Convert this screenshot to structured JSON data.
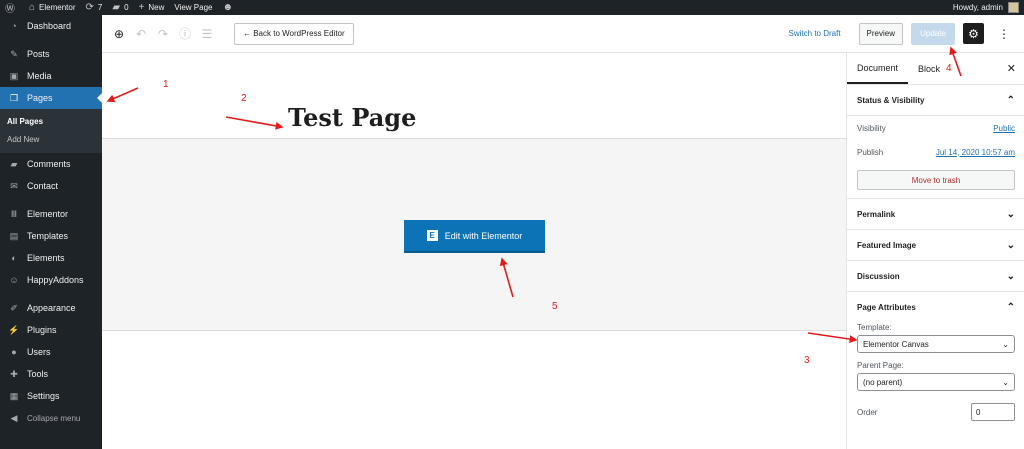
{
  "adminbar": {
    "site_name": "Elementor",
    "updates_count": "7",
    "comments_count": "0",
    "new_label": "New",
    "view_page_label": "View Page",
    "greeting": "Howdy, admin"
  },
  "sidebar": {
    "items": [
      {
        "label": "Dashboard",
        "icon": "dashboard-icon"
      },
      {
        "label": "Posts",
        "icon": "pin-icon"
      },
      {
        "label": "Media",
        "icon": "media-icon"
      },
      {
        "label": "Pages",
        "icon": "pages-icon"
      },
      {
        "label": "Comments",
        "icon": "comment-icon"
      },
      {
        "label": "Contact",
        "icon": "mail-icon"
      },
      {
        "label": "Elementor",
        "icon": "elementor-icon"
      },
      {
        "label": "Templates",
        "icon": "folder-icon"
      },
      {
        "label": "Elements",
        "icon": "elements-icon"
      },
      {
        "label": "HappyAddons",
        "icon": "happy-icon"
      },
      {
        "label": "Appearance",
        "icon": "brush-icon"
      },
      {
        "label": "Plugins",
        "icon": "plug-icon"
      },
      {
        "label": "Users",
        "icon": "user-icon"
      },
      {
        "label": "Tools",
        "icon": "wrench-icon"
      },
      {
        "label": "Settings",
        "icon": "settings-icon"
      }
    ],
    "submenu": [
      "All Pages",
      "Add New"
    ],
    "collapse_label": "Collapse menu"
  },
  "toolbar": {
    "back_label": "← Back to WordPress Editor",
    "switch_draft_label": "Switch to Draft",
    "preview_label": "Preview",
    "update_label": "Update"
  },
  "canvas": {
    "page_title": "Test Page",
    "elementor_button_label": "Edit with Elementor",
    "elementor_logo_letter": "E"
  },
  "panel": {
    "tabs": [
      "Document",
      "Block"
    ],
    "status_visibility": {
      "title": "Status & Visibility",
      "visibility_label": "Visibility",
      "visibility_value": "Public",
      "publish_label": "Publish",
      "publish_value": "Jul 14, 2020 10:57 am",
      "trash_label": "Move to trash"
    },
    "sections": [
      "Permalink",
      "Featured Image",
      "Discussion"
    ],
    "page_attributes": {
      "title": "Page Attributes",
      "template_label": "Template:",
      "template_value": "Elementor Canvas",
      "parent_label": "Parent Page:",
      "parent_value": "(no parent)",
      "order_label": "Order",
      "order_value": "0"
    }
  },
  "annotations": {
    "color": "#e21b1b",
    "labels": [
      "1",
      "2",
      "3",
      "4",
      "5"
    ]
  }
}
